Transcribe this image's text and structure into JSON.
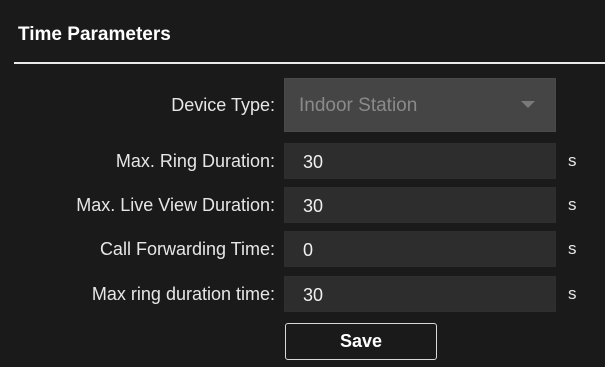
{
  "header": {
    "title": "Time Parameters"
  },
  "form": {
    "device_type": {
      "label": "Device Type:",
      "value": "Indoor Station",
      "icon": "chevron-down-icon"
    },
    "max_ring_duration": {
      "label": "Max. Ring Duration:",
      "value": "30",
      "unit": "s"
    },
    "max_live_view_duration": {
      "label": "Max. Live View Duration:",
      "value": "30",
      "unit": "s"
    },
    "call_forwarding_time": {
      "label": "Call Forwarding Time:",
      "value": "0",
      "unit": "s"
    },
    "max_ring_duration_time": {
      "label": "Max ring duration time:",
      "value": "30",
      "unit": "s"
    },
    "save_label": "Save"
  }
}
